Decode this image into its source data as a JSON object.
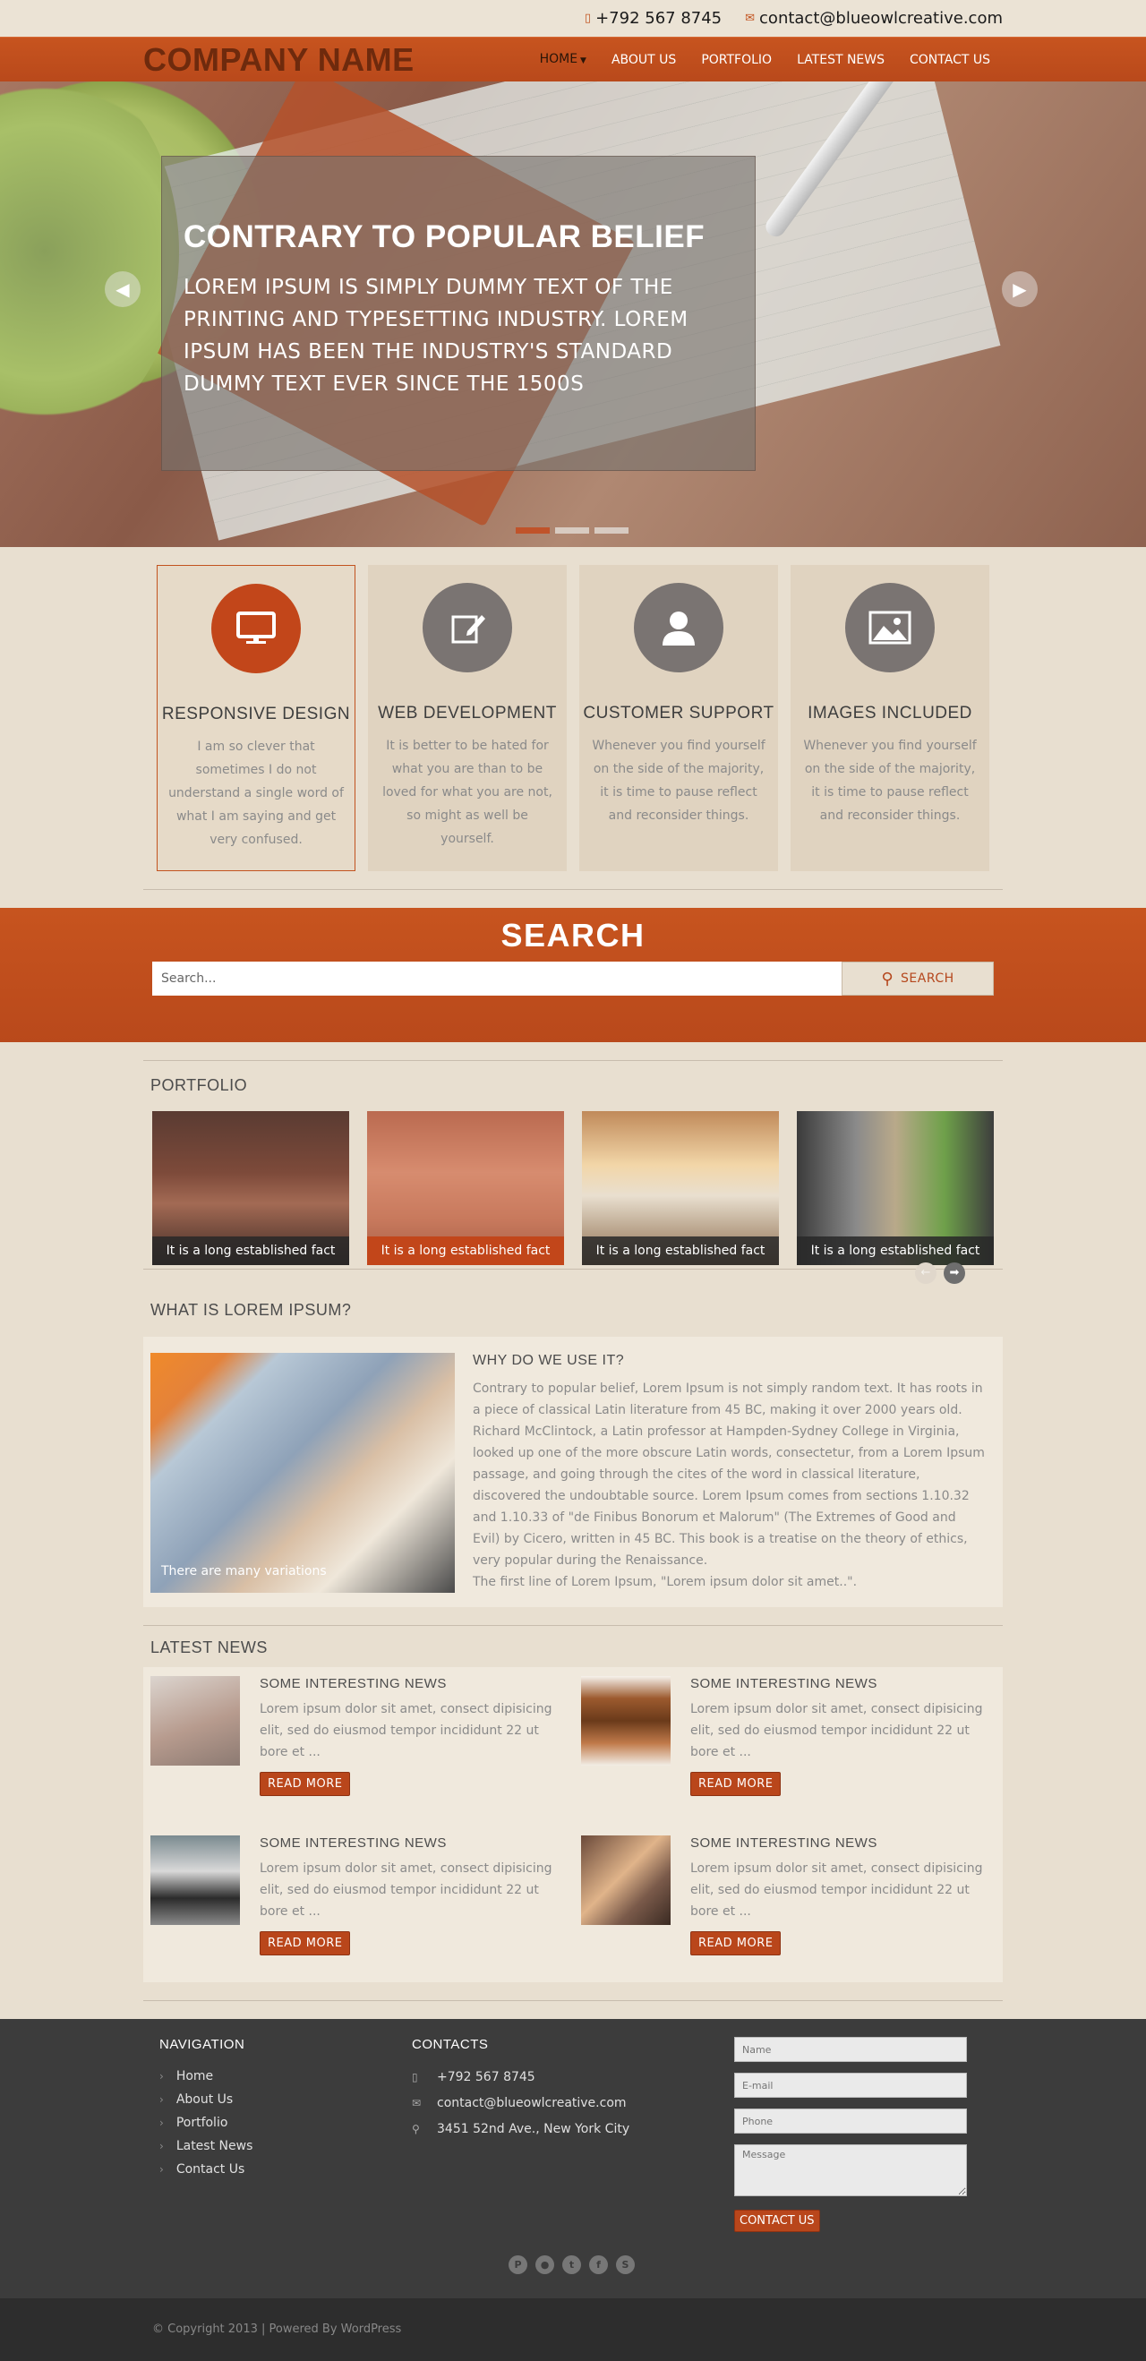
{
  "topbar": {
    "phone": "+792 567 8745",
    "email": "contact@blueowlcreative.com"
  },
  "header": {
    "logo": "COMPANY NAME",
    "nav": [
      {
        "label": "HOME",
        "active": true
      },
      {
        "label": "ABOUT US"
      },
      {
        "label": "PORTFOLIO"
      },
      {
        "label": "LATEST NEWS"
      },
      {
        "label": "CONTACT US"
      }
    ]
  },
  "hero": {
    "title": "CONTRARY TO POPULAR BELIEF",
    "text": "LOREM IPSUM IS SIMPLY DUMMY TEXT OF THE PRINTING AND TYPESETTING INDUSTRY. LOREM IPSUM HAS BEEN THE INDUSTRY'S STANDARD DUMMY TEXT EVER SINCE THE 1500S",
    "prev": "◀",
    "next": "▶"
  },
  "features": [
    {
      "icon": "monitor-icon",
      "title": "RESPONSIVE DESIGN",
      "text": "I am so clever that sometimes I do not  understand a single word of what I am saying and get very confused."
    },
    {
      "icon": "edit-icon",
      "title": "WEB DEVELOPMENT",
      "text": "It is better to be hated for what you are than to be loved for what you are not, so might as well be yourself."
    },
    {
      "icon": "user-icon",
      "title": "CUSTOMER SUPPORT",
      "text": "Whenever you find yourself on the side of the majority, it is time to pause reflect and reconsider things."
    },
    {
      "icon": "image-icon",
      "title": "IMAGES INCLUDED",
      "text": "Whenever you find yourself on the side of the majority, it is time to pause reflect and reconsider things."
    }
  ],
  "search": {
    "title": "SEARCH",
    "placeholder": "Search...",
    "button": "SEARCH"
  },
  "portfolio": {
    "title": "PORTFOLIO",
    "items": [
      {
        "caption": "It is a long established fact"
      },
      {
        "caption": "It is a long established fact"
      },
      {
        "caption": "It is a long established fact"
      },
      {
        "caption": "It is a long established fact"
      }
    ],
    "prev": "←",
    "next": "➡"
  },
  "lorem": {
    "title": "WHAT IS LOREM IPSUM?",
    "image_caption": "There are many variations",
    "subtitle": "WHY DO WE USE IT?",
    "text": "Contrary to popular belief, Lorem Ipsum is not simply random text. It has roots in a piece of classical Latin literature from 45 BC, making it over 2000 years old. Richard McClintock, a Latin professor at Hampden-Sydney College in Virginia, looked up one of the more obscure Latin words, consectetur, from a Lorem Ipsum passage, and going through the cites of the word in classical literature, discovered the undoubtable source. Lorem Ipsum comes from sections 1.10.32 and 1.10.33 of \"de Finibus Bonorum et Malorum\" (The Extremes of Good and Evil) by Cicero, written in 45 BC. This book is a treatise on the theory of ethics, very popular during the Renaissance.",
    "text2": "The first line of Lorem Ipsum, \"Lorem ipsum dolor sit amet..\"."
  },
  "news": {
    "title": "LATEST NEWS",
    "items": [
      {
        "title": "SOME INTERESTING NEWS",
        "text": "Lorem ipsum dolor sit amet, consect dipisicing elit, sed do eiusmod tempor incididunt 22 ut bore et ...",
        "button": "READ MORE"
      },
      {
        "title": "SOME INTERESTING NEWS",
        "text": "Lorem ipsum dolor sit amet, consect dipisicing elit, sed do eiusmod tempor incididunt 22 ut bore et ...",
        "button": "READ MORE"
      },
      {
        "title": "SOME INTERESTING NEWS",
        "text": "Lorem ipsum dolor sit amet, consect dipisicing elit, sed do eiusmod tempor incididunt 22 ut bore et ...",
        "button": "READ MORE"
      },
      {
        "title": "SOME INTERESTING NEWS",
        "text": "Lorem ipsum dolor sit amet, consect dipisicing elit, sed do eiusmod tempor incididunt 22 ut bore et ...",
        "button": "READ MORE"
      }
    ]
  },
  "footer": {
    "nav_title": "NAVIGATION",
    "nav": [
      "Home",
      "About Us",
      "Portfolio",
      "Latest News",
      "Contact Us"
    ],
    "contacts_title": "CONTACTS",
    "phone": "+792 567 8745",
    "email": "contact@blueowlcreative.com",
    "address": "3451 52nd Ave., New York City",
    "form": {
      "name": "Name",
      "email": "E-mail",
      "phone": "Phone",
      "message": "Message",
      "button": "CONTACT US"
    },
    "social": [
      "pinterest-icon",
      "dribbble-icon",
      "twitter-icon",
      "facebook-icon",
      "skype-icon"
    ],
    "copyright": "© Copyright 2013  | Powered By WordPress"
  },
  "colors": {
    "accent": "#c2531f",
    "background": "#e8dfd0",
    "footer": "#3c3c3c"
  }
}
